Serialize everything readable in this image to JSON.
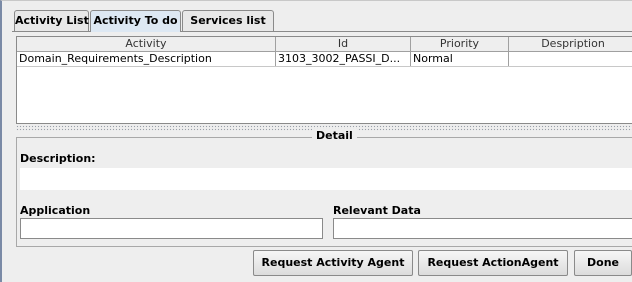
{
  "tabs": [
    {
      "label": "Activity List",
      "active": false
    },
    {
      "label": "Activity To do",
      "active": true
    },
    {
      "label": "Services list",
      "active": false
    }
  ],
  "table": {
    "columns": [
      "Activity",
      "Id",
      "Priority",
      "Despription"
    ],
    "rows": [
      [
        "Domain_Requirements_Description",
        "3103_3002_PASSI_D...",
        "Normal",
        ""
      ]
    ]
  },
  "detail": {
    "title": "Detail",
    "description_label": "Description:",
    "description_value": "",
    "application_label": "Application",
    "application_value": "",
    "relevant_data_label": "Relevant Data",
    "relevant_data_value": ""
  },
  "buttons": {
    "request_activity_agent": "Request Activity Agent",
    "request_action_agent": "Request ActionAgent",
    "done": "Done"
  },
  "colors": {
    "panel_bg": "#eeeeee",
    "active_tab_bg": "#dde8f3",
    "window_edge": "#7a8aa6"
  }
}
